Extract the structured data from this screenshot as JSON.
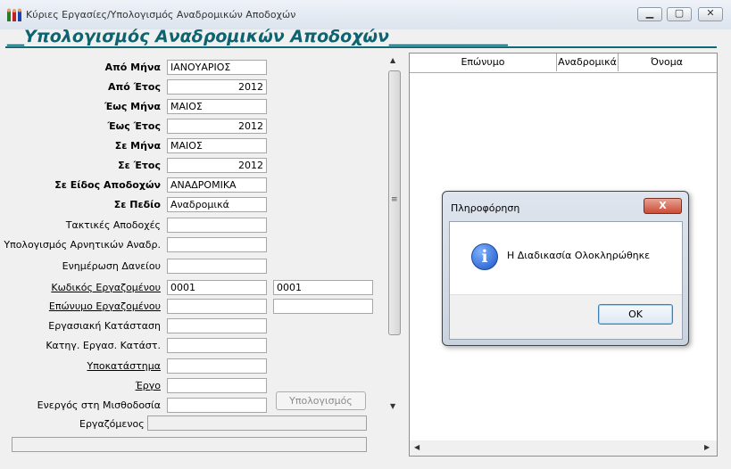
{
  "window": {
    "title": "Κύριες Εργασίες/Υπολογισμός Αναδρομικών Αποδοχών"
  },
  "form": {
    "heading": "__Υπολογισμός Αναδρομικών Αποδοχών______________",
    "labels": {
      "from_month": "Από Μήνα",
      "from_year": "Από Έτος",
      "to_month": "Έως Μήνα",
      "to_year": "Έως Έτος",
      "in_month": "Σε Μήνα",
      "in_year": "Σε Έτος",
      "in_earnings_type": "Σε Είδος Αποδοχών",
      "in_field": "Σε Πεδίο",
      "regular_earnings": "Τακτικές Αποδοχές",
      "negative_calc": "Υπολογισμός Αρνητικών Αναδρ.",
      "loan_update": "Ενημέρωση Δανείου",
      "employee_code": "Κωδικός Εργαζομένου",
      "employee_surname": "Επώνυμο Εργαζομένου",
      "work_status": "Εργασιακή Κατάσταση",
      "status_category": "Κατηγ. Εργασ. Κατάστ.",
      "branch": "Υποκατάστημα",
      "project": "Έργο",
      "active_payroll": "Ενεργός στη Μισθοδοσία",
      "employee": "Εργαζόμενος"
    },
    "values": {
      "from_month": "ΙΑΝΟΥΑΡΙΟΣ",
      "from_year": "2012",
      "to_month": "ΜΑΙΟΣ",
      "to_year": "2012",
      "in_month": "ΜΑΙΟΣ",
      "in_year": "2012",
      "in_earnings_type": "ΑΝΑΔΡΟΜΙΚΑ",
      "in_field": "Αναδρομικά",
      "employee_code_from": "0001",
      "employee_code_to": "0001"
    },
    "calculate_button": "Υπολογισμός"
  },
  "grid": {
    "columns": [
      "Επώνυμο",
      "Αναδρομικά",
      "Όνομα"
    ]
  },
  "dialog": {
    "title": "Πληροφόρηση",
    "close_glyph": "X",
    "message": "Η Διαδικασία Ολοκληρώθηκε",
    "ok": "OK",
    "icon": "info-icon"
  }
}
